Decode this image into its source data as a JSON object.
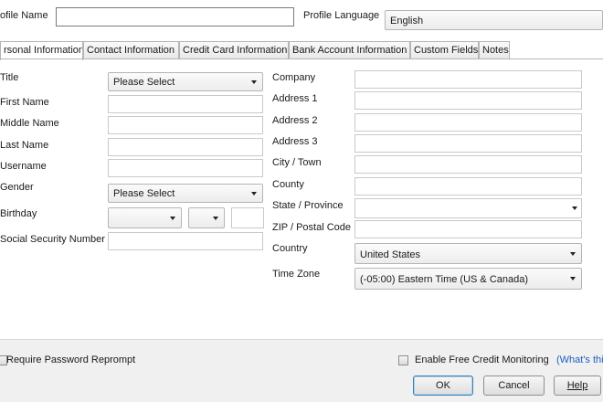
{
  "header": {
    "profile_name_label": "ofile Name",
    "profile_name_value": "",
    "profile_language_label": "Profile Language",
    "profile_language_value": "English"
  },
  "tabs": [
    {
      "label": "rsonal Information",
      "active": true
    },
    {
      "label": "Contact Information",
      "active": false
    },
    {
      "label": "Credit Card Information",
      "active": false
    },
    {
      "label": "Bank Account Information",
      "active": false
    },
    {
      "label": "Custom Fields",
      "active": false
    },
    {
      "label": "Notes",
      "active": false
    }
  ],
  "personal": {
    "title_label": "Title",
    "title_value": "Please Select",
    "first_name_label": "First Name",
    "middle_name_label": "Middle Name",
    "last_name_label": "Last Name",
    "username_label": "Username",
    "gender_label": "Gender",
    "gender_value": "Please Select",
    "birthday_label": "Birthday",
    "birthday_month": "",
    "birthday_day": "",
    "birthday_year": "",
    "ssn_label": "Social Security Number"
  },
  "address": {
    "company_label": "Company",
    "address1_label": "Address 1",
    "address2_label": "Address 2",
    "address3_label": "Address 3",
    "city_label": "City / Town",
    "county_label": "County",
    "state_label": "State / Province",
    "state_value": "",
    "zip_label": "ZIP / Postal Code",
    "country_label": "Country",
    "country_value": "United States",
    "timezone_label": "Time Zone",
    "timezone_value": "(-05:00) Eastern Time (US & Canada)"
  },
  "footer": {
    "reprompt_label": "Require Password Reprompt",
    "credit_monitoring_label": "Enable Free Credit Monitoring",
    "whats_this_link": "(What's thi",
    "ok_label": "OK",
    "cancel_label": "Cancel",
    "help_label": "Help"
  }
}
